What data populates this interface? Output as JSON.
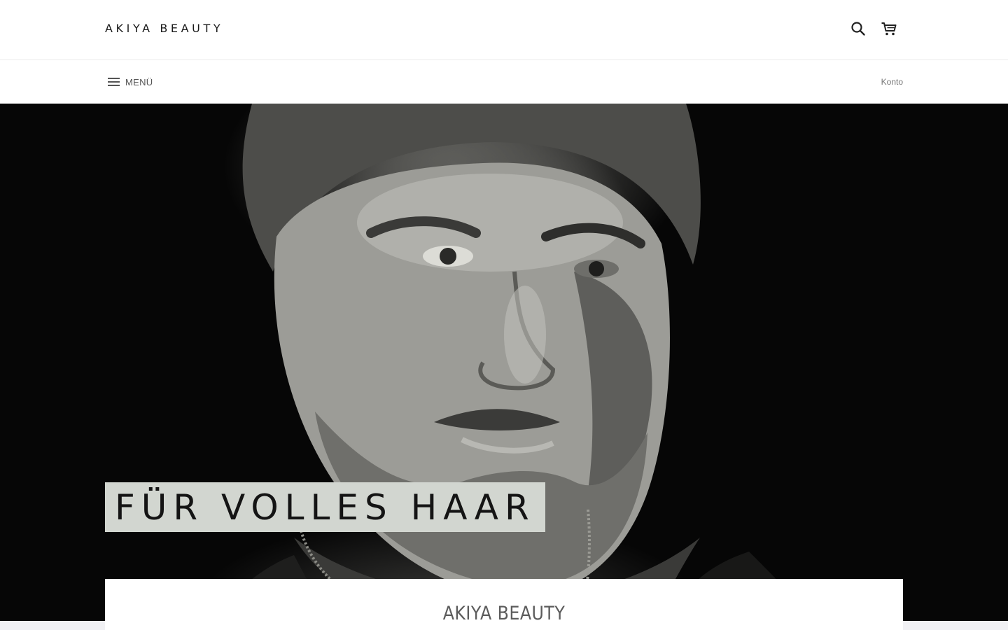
{
  "header": {
    "logo_text": "AKIYA BEAUTY",
    "search_icon": "search-icon",
    "cart_icon": "cart-icon"
  },
  "nav": {
    "menu_label": "MENÜ",
    "menu_icon": "hamburger-icon",
    "account_label": "Konto"
  },
  "hero": {
    "caption": "FÜR VOLLES HAAR",
    "caption_bg": "#d2d6d0",
    "image_description_icon": "portrait-image"
  },
  "content": {
    "section_title": "AKIYA BEAUTY"
  },
  "colors": {
    "header_bg": "#ffffff",
    "hero_bg": "#060606",
    "text_dark": "#1b1b1b",
    "text_muted": "#777777"
  }
}
